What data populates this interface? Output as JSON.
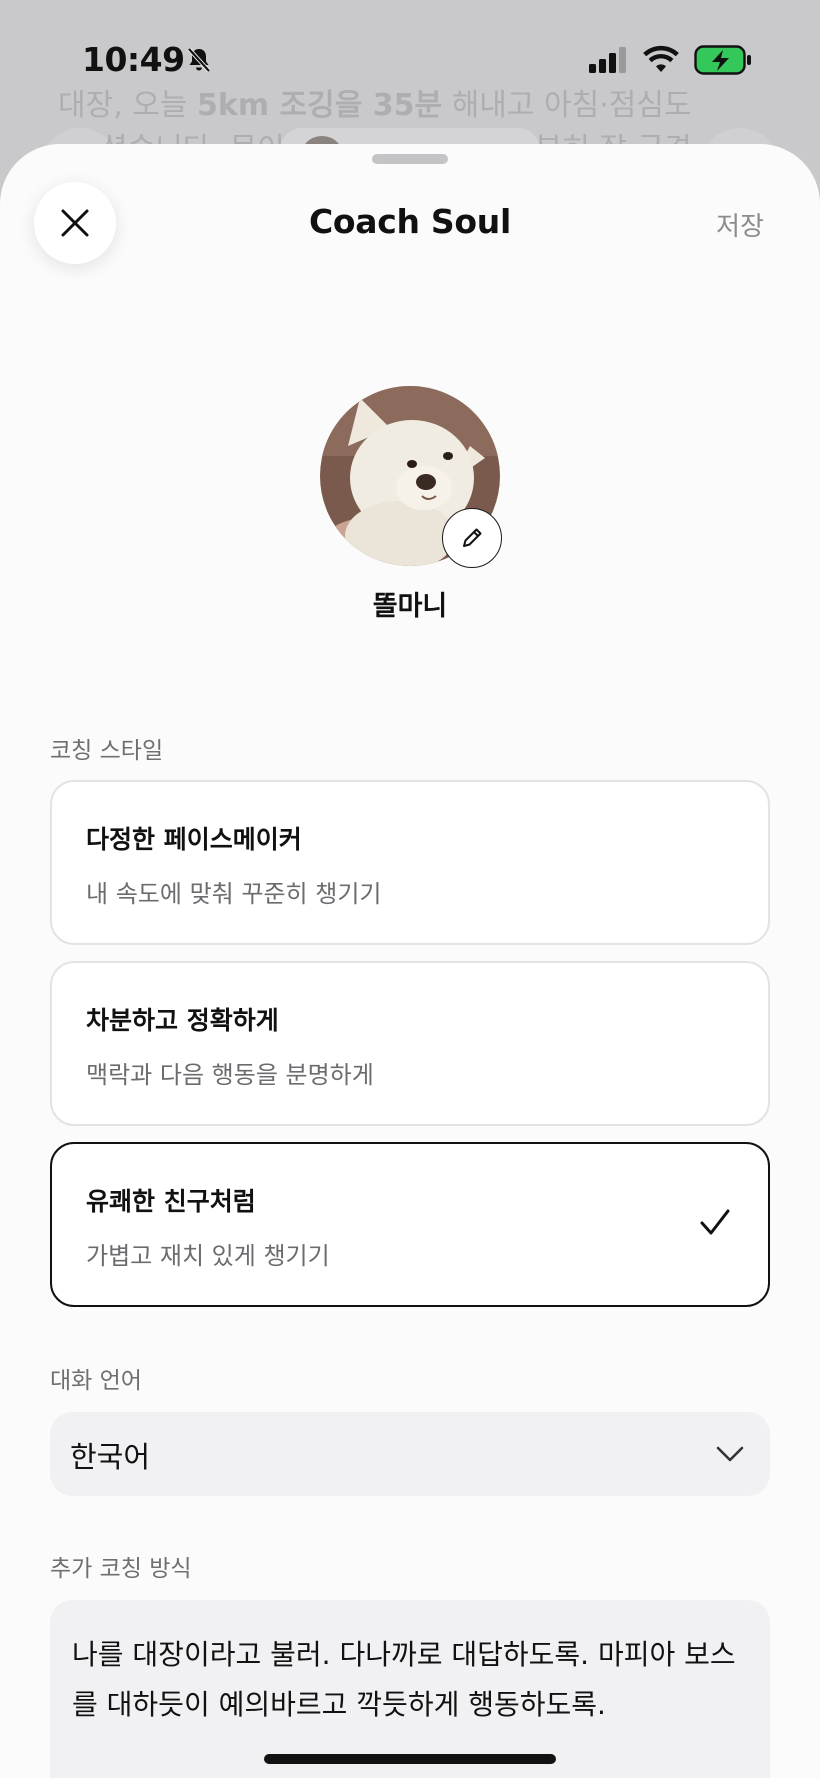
{
  "status_bar": {
    "time": "10:49"
  },
  "background": {
    "line1_a": "대장, 오늘 ",
    "line1_b": "5km 조깅을 35분",
    "line1_c": " 해내고 아침·점심도",
    "line2_a": "셨습니다. 몸이",
    "line2_b": "분히 잘 극격"
  },
  "sheet": {
    "title": "Coach Soul",
    "save_label": "저장",
    "coach_name": "똘마니",
    "coaching_style_label": "코칭 스타일",
    "styles": [
      {
        "title": "다정한 페이스메이커",
        "desc": "내 속도에 맞춰 꾸준히 챙기기",
        "selected": false
      },
      {
        "title": "차분하고 정확하게",
        "desc": "맥락과 다음 행동을 분명하게",
        "selected": false
      },
      {
        "title": "유쾌한 친구처럼",
        "desc": "가볍고 재치 있게 챙기기",
        "selected": true
      }
    ],
    "language_label": "대화 언어",
    "language_value": "한국어",
    "extra_label": "추가 코칭 방식",
    "extra_text": "나를 대장이라고 불러. 다나까로 대답하도록. 마피아 보스를 대하듯이 예의바르고 깍듯하게 행동하도록."
  },
  "icons": {
    "close": "close-icon",
    "edit": "pencil-icon",
    "check": "check-icon",
    "chevron": "chevron-down-icon",
    "bell_off": "bell-slash-icon",
    "signal": "cellular-signal-icon",
    "wifi": "wifi-icon",
    "battery": "battery-charging-icon"
  },
  "colors": {
    "battery_fill": "#34c759",
    "selected_border": "#111111",
    "card_border": "#e3e3e5",
    "input_bg": "#f1f1f3"
  }
}
